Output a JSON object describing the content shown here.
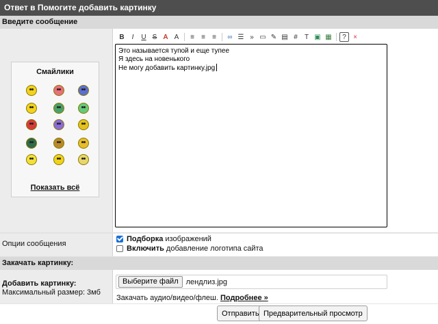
{
  "window": {
    "title": "Ответ в Помогите добавить картинку"
  },
  "sections": {
    "message": "Введите сообщение",
    "upload": "Закачать картинку:"
  },
  "smilies": {
    "title": "Смайлики",
    "show_all": "Показать всё",
    "icons": [
      {
        "name": "smile-icon",
        "color": "#f2d21b"
      },
      {
        "name": "in-love-icon",
        "color": "#e8707a"
      },
      {
        "name": "alien-icon",
        "color": "#5b6fcf"
      },
      {
        "name": "thinking-icon",
        "color": "#f2d21b"
      },
      {
        "name": "gun-icon",
        "color": "#4aa26a"
      },
      {
        "name": "green-face-icon",
        "color": "#65c97a"
      },
      {
        "name": "shooter-icon",
        "color": "#d83a3a"
      },
      {
        "name": "devil-icon",
        "color": "#8b6cd8"
      },
      {
        "name": "wave-icon",
        "color": "#e4c21c"
      },
      {
        "name": "ninja-icon",
        "color": "#2f6a4b"
      },
      {
        "name": "book-icon",
        "color": "#b8892b"
      },
      {
        "name": "cheer-icon",
        "color": "#e8bd2a"
      },
      {
        "name": "hang-icon",
        "color": "#f2e03a"
      },
      {
        "name": "laugh-icon",
        "color": "#f0d21a"
      },
      {
        "name": "star-icon",
        "color": "#e8d66a"
      }
    ]
  },
  "toolbar": {
    "items": [
      {
        "name": "bold-icon",
        "glyph": "B"
      },
      {
        "name": "italic-icon",
        "glyph": "I"
      },
      {
        "name": "underline-icon",
        "glyph": "U"
      },
      {
        "name": "strike-icon",
        "glyph": "S"
      },
      {
        "name": "text-color-icon",
        "glyph": "A"
      },
      {
        "name": "font-size-icon",
        "glyph": "A"
      },
      {
        "name": "align-left-icon",
        "glyph": "≡"
      },
      {
        "name": "align-center-icon",
        "glyph": "≡"
      },
      {
        "name": "align-right-icon",
        "glyph": "≡"
      },
      {
        "name": "link-icon",
        "glyph": "∞"
      },
      {
        "name": "list-icon",
        "glyph": "☰"
      },
      {
        "name": "quote-icon",
        "glyph": "»"
      },
      {
        "name": "code-icon",
        "glyph": "▭"
      },
      {
        "name": "insert-icon",
        "glyph": "✎"
      },
      {
        "name": "spoiler-icon",
        "glyph": "▤"
      },
      {
        "name": "hr-icon",
        "glyph": "#"
      },
      {
        "name": "text-icon",
        "glyph": "T"
      },
      {
        "name": "image-icon",
        "glyph": "▣"
      },
      {
        "name": "video-icon",
        "glyph": "▦"
      },
      {
        "name": "help-icon",
        "glyph": "?"
      },
      {
        "name": "clear-icon",
        "glyph": "×"
      }
    ]
  },
  "editor": {
    "lines": [
      "Это называется тупой и еще тупее",
      "Я здесь на новенького",
      "Не могу добавить картинку.jpg"
    ]
  },
  "options": {
    "label": "Опции сообщения",
    "items": [
      {
        "bold": "Подборка",
        "rest": " изображений",
        "checked": true
      },
      {
        "bold": "Включить",
        "rest": " добавление логотипа сайта",
        "checked": false
      }
    ]
  },
  "upload": {
    "label": "Добавить картинку:",
    "max_size": "Максимальный размер: 3мб",
    "choose_button": "Выберите файл",
    "file_name": "лендлиз.jpg",
    "media_text": "Закачать аудио/видео/флеш.",
    "media_link": "Подробнее »"
  },
  "actions": {
    "submit": "Отправить",
    "preview": "Предварительный просмотр"
  }
}
